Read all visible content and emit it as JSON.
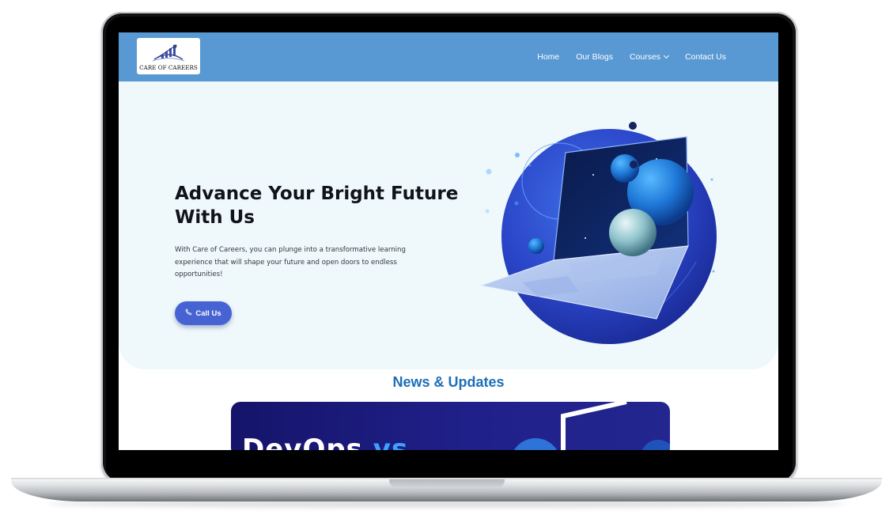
{
  "site": {
    "logo_text": "CARE OF CAREERS",
    "logo_icon": "bar-chart-logo-icon"
  },
  "nav": {
    "items": [
      {
        "label": "Home"
      },
      {
        "label": "Our Blogs"
      },
      {
        "label": "Courses",
        "has_dropdown": true
      },
      {
        "label": "Contact Us"
      }
    ]
  },
  "hero": {
    "title": "Advance Your Bright Future With Us",
    "description": "With Care of Careers, you can plunge into a transformative learning experience that will shape your future and open doors to endless opportunities!",
    "cta_label": "Call Us",
    "cta_icon": "phone-icon",
    "illustration": "laptop-spheres-illustration"
  },
  "news": {
    "title": "News & Updates",
    "card_text_main": "DevOps",
    "card_text_accent": "vs"
  },
  "colors": {
    "header_bg": "#5898d3",
    "hero_bg": "#eff8fa",
    "cta_bg": "#4763d3",
    "news_title": "#1d6fb8",
    "card_bg": "#1a1a7a"
  }
}
